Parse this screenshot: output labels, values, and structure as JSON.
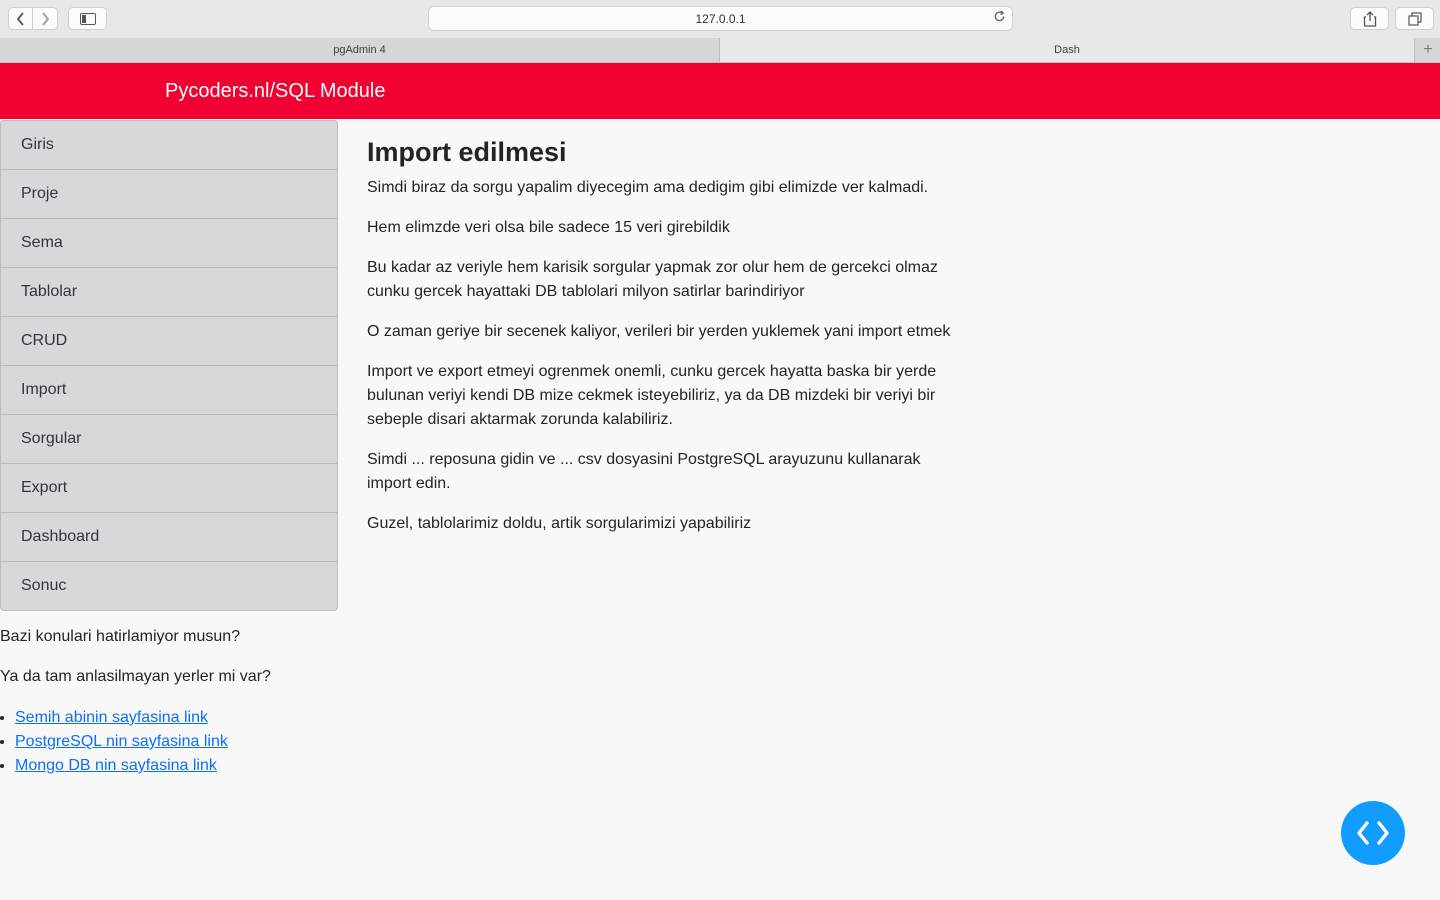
{
  "browser": {
    "url": "127.0.0.1",
    "tabs": [
      {
        "label": "pgAdmin 4"
      },
      {
        "label": "Dash"
      }
    ],
    "new_tab_label": "+"
  },
  "header": {
    "brand": "Pycoders.nl/SQL Module",
    "accent_color": "#f10032"
  },
  "menu": {
    "items": [
      {
        "label": "Giris"
      },
      {
        "label": "Proje"
      },
      {
        "label": "Sema"
      },
      {
        "label": "Tablolar"
      },
      {
        "label": "CRUD"
      },
      {
        "label": "Import"
      },
      {
        "label": "Sorgular"
      },
      {
        "label": "Export"
      },
      {
        "label": "Dashboard"
      },
      {
        "label": "Sonuc"
      }
    ]
  },
  "sidebar": {
    "question1": "Bazi konulari hatirlamiyor musun?",
    "question2": "Ya da tam anlasilmayan yerler mi var?",
    "links": [
      {
        "label": "Semih abinin sayfasina link"
      },
      {
        "label": "PostgreSQL nin sayfasina link"
      },
      {
        "label": "Mongo DB nin sayfasina link"
      }
    ]
  },
  "main": {
    "title": "Import edilmesi",
    "paragraphs": [
      "Simdi biraz da sorgu yapalim diyecegim ama dedigim gibi elimizde ver kalmadi.",
      "Hem elimzde veri olsa bile sadece 15 veri girebildik",
      "Bu kadar az veriyle hem karisik sorgular yapmak zor olur hem de gercekci olmaz cunku gercek hayattaki DB tablolari milyon satirlar barindiriyor",
      "O zaman geriye bir secenek kaliyor, verileri bir yerden yuklemek yani import etmek",
      "Import ve export etmeyi ogrenmek onemli, cunku gercek hayatta baska bir yerde bulunan veriyi kendi DB mize cekmek isteyebiliriz, ya da DB mizdeki bir veriyi bir sebeple disari aktarmak zorunda kalabiliriz.",
      "Simdi ... reposuna gidin ve ... csv dosyasini PostgreSQL arayuzunu kullanarak import edin.",
      "Guzel, tablolarimiz doldu, artik sorgularimizi yapabiliriz"
    ]
  },
  "debug_button": {
    "icon": "code-icon",
    "color": "#119dff"
  }
}
